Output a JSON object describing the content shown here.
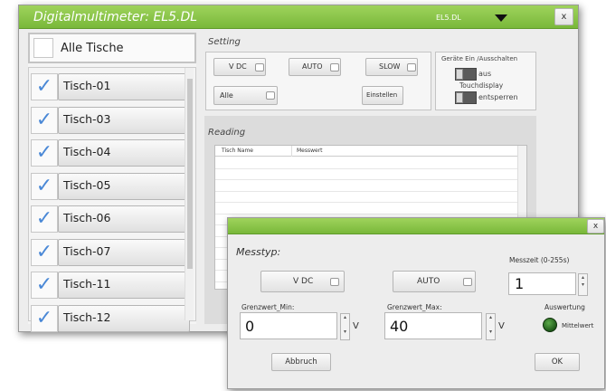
{
  "main_window": {
    "title": "Digitalmultimeter: EL5.DL",
    "device_tag": "EL5.DL",
    "close_label": "x"
  },
  "tische": {
    "all_label": "Alle Tische",
    "check_glyph": "✓",
    "items": [
      "Tisch-01",
      "Tisch-03",
      "Tisch-04",
      "Tisch-05",
      "Tisch-06",
      "Tisch-07",
      "Tisch-11",
      "Tisch-12"
    ]
  },
  "setting": {
    "title": "Setting",
    "mode": "V DC",
    "range": "AUTO",
    "speed": "SLOW",
    "filter": "Alle",
    "einstellen": "Einstellen",
    "power_label": "Geräte Ein /Ausschalten",
    "power_state": "aus",
    "touch_label": "Touchdisplay",
    "touch_state": "entsperren"
  },
  "reading": {
    "title": "Reading",
    "columns": [
      "Tisch Name",
      "Messwert"
    ]
  },
  "dialog": {
    "close_label": "x",
    "messtyp_label": "Messtyp:",
    "mode": "V DC",
    "range": "AUTO",
    "messzeit_label": "Messzeit (0-255s)",
    "messzeit_value": "1",
    "min_label": "Grenzwert_Min:",
    "min_value": "0",
    "min_unit": "V",
    "max_label": "Grenzwert_Max:",
    "max_value": "40",
    "max_unit": "V",
    "auswertung_label": "Auswertung",
    "mittelwert_label": "Mittelwert",
    "abbruch": "Abbruch",
    "ok": "OK"
  },
  "colors": {
    "titlebar": "#8cc64b",
    "check": "#4a88d6",
    "indicator": "#1f5a1a"
  }
}
